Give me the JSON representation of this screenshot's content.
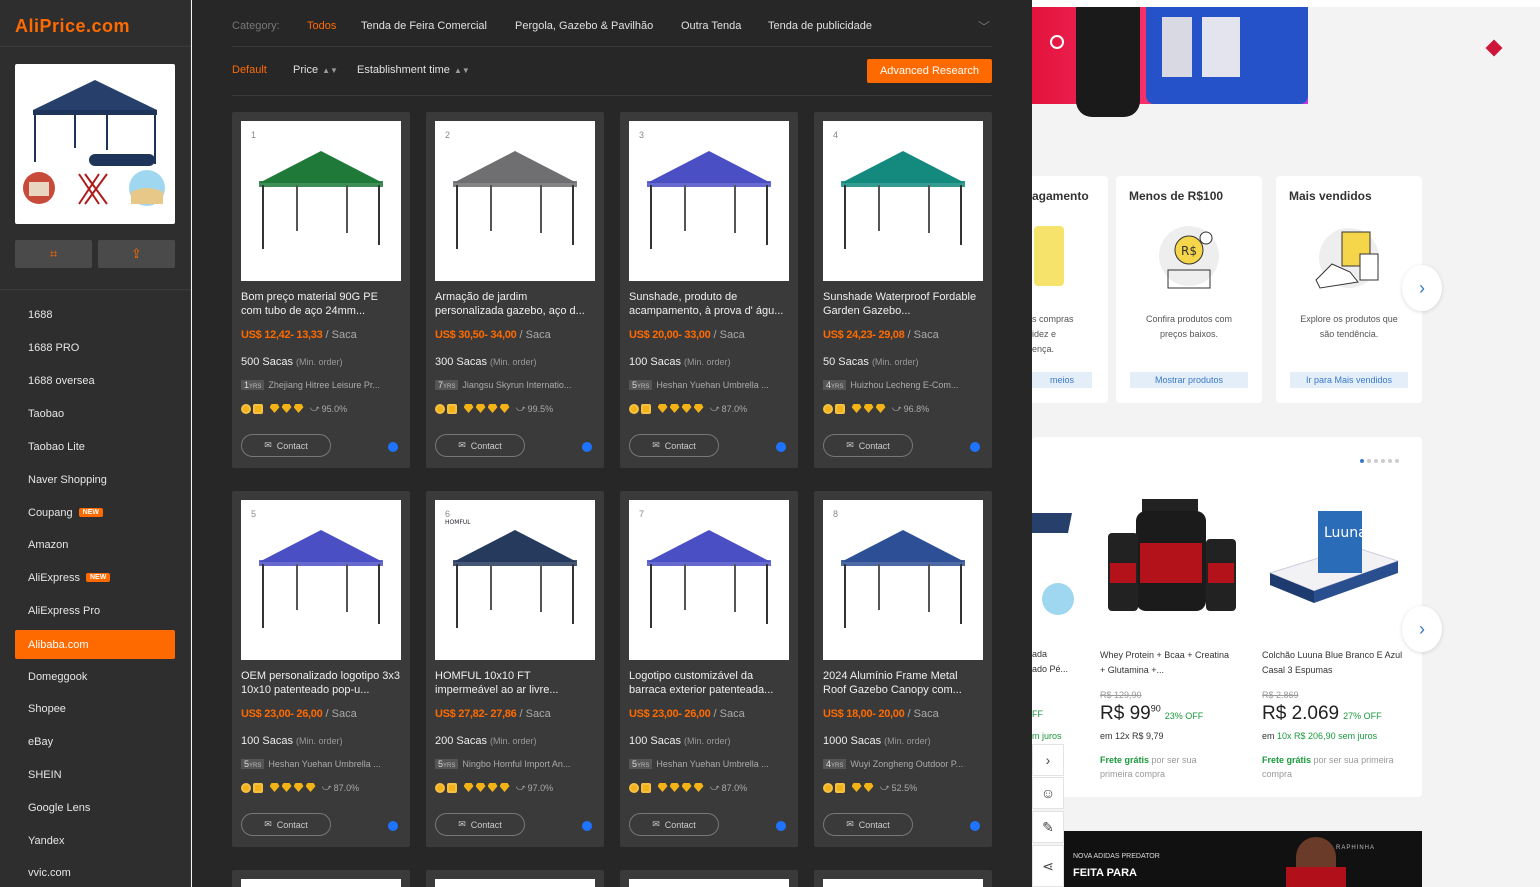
{
  "sidebar": {
    "logo": "AliPrice.com",
    "items": [
      {
        "label": "1688"
      },
      {
        "label": "1688 PRO"
      },
      {
        "label": "1688 oversea"
      },
      {
        "label": "Taobao"
      },
      {
        "label": "Taobao Lite"
      },
      {
        "label": "Naver Shopping"
      },
      {
        "label": "Coupang",
        "badge": "NEW"
      },
      {
        "label": "Amazon"
      },
      {
        "label": "AliExpress",
        "badge": "NEW"
      },
      {
        "label": "AliExpress Pro"
      },
      {
        "label": "Alibaba.com",
        "active": true
      },
      {
        "label": "Domeggook"
      },
      {
        "label": "Shopee"
      },
      {
        "label": "eBay"
      },
      {
        "label": "SHEIN"
      },
      {
        "label": "Google Lens"
      },
      {
        "label": "Yandex"
      },
      {
        "label": "vvic.com"
      }
    ],
    "crop_icon": "crop-icon",
    "upload_icon": "upload-icon"
  },
  "categories": {
    "label": "Category:",
    "items": [
      "Todos",
      "Tenda de Feira Comercial",
      "Pergola, Gazebo & Pavilhão",
      "Outra Tenda",
      "Tenda de publicidade"
    ],
    "selected": "Todos"
  },
  "sort": {
    "default": "Default",
    "price": "Price",
    "establishment": "Establishment time",
    "advanced": "Advanced Research"
  },
  "products": [
    {
      "num": "1",
      "title": "Bom preço material 90G PE com tubo de aço 24mm...",
      "price": "US$ 12,42- 13,33",
      "unit": "/ Saca",
      "moq": "500 Sacas",
      "moq_label": "(Min. order)",
      "yrs": "1",
      "yrs_label": "YRS",
      "supplier": "Zhejiang Hitree Leisure Pr...",
      "rating": "95.0%",
      "diamonds": 3,
      "color": "#1f7a3a",
      "contact": "Contact"
    },
    {
      "num": "2",
      "title": "Armação de jardim personalizada gazebo, aço d...",
      "price": "US$ 30,50- 34,00",
      "unit": "/ Saca",
      "moq": "300 Sacas",
      "moq_label": "(Min. order)",
      "yrs": "7",
      "yrs_label": "YRS",
      "supplier": "Jiangsu Skyrun Internatio...",
      "rating": "99.5%",
      "diamonds": 4,
      "color": "#6f6f72",
      "contact": "Contact"
    },
    {
      "num": "3",
      "title": "Sunshade, produto de acampamento, à prova d' águ...",
      "price": "US$ 20,00- 33,00",
      "unit": "/ Saca",
      "moq": "100 Sacas",
      "moq_label": "(Min. order)",
      "yrs": "5",
      "yrs_label": "YRS",
      "supplier": "Heshan Yuehan Umbrella ...",
      "rating": "87.0%",
      "diamonds": 4,
      "color": "#4b4fc4",
      "contact": "Contact"
    },
    {
      "num": "4",
      "title": "Sunshade Waterproof Fordable Garden Gazebo...",
      "price": "US$ 24,23- 29,08",
      "unit": "/ Saca",
      "moq": "50 Sacas",
      "moq_label": "(Min. order)",
      "yrs": "4",
      "yrs_label": "YRS",
      "supplier": "Huizhou Lecheng E-Com...",
      "rating": "96.8%",
      "diamonds": 3,
      "color": "#138a7d",
      "contact": "Contact"
    },
    {
      "num": "5",
      "title": "OEM personalizado logotipo 3x3 10x10 patenteado pop-u...",
      "price": "US$ 23,00- 26,00",
      "unit": "/ Saca",
      "moq": "100 Sacas",
      "moq_label": "(Min. order)",
      "yrs": "5",
      "yrs_label": "YRS",
      "supplier": "Heshan Yuehan Umbrella ...",
      "rating": "87.0%",
      "diamonds": 4,
      "color": "#4b4fc4",
      "contact": "Contact"
    },
    {
      "num": "6",
      "title": "HOMFUL 10x10 FT impermeável ao ar livre...",
      "price": "US$ 27,82- 27,86",
      "unit": "/ Saca",
      "moq": "200 Sacas",
      "moq_label": "(Min. order)",
      "yrs": "5",
      "yrs_label": "YRS",
      "supplier": "Ningbo Homful Import An...",
      "rating": "97.0%",
      "diamonds": 4,
      "color": "#263a5e",
      "contact": "Contact",
      "brand": "HOMFUL"
    },
    {
      "num": "7",
      "title": "Logotipo customizável da barraca exterior patenteada...",
      "price": "US$ 23,00- 26,00",
      "unit": "/ Saca",
      "moq": "100 Sacas",
      "moq_label": "(Min. order)",
      "yrs": "5",
      "yrs_label": "YRS",
      "supplier": "Heshan Yuehan Umbrella ...",
      "rating": "87.0%",
      "diamonds": 4,
      "color": "#4b4fc4",
      "contact": "Contact"
    },
    {
      "num": "8",
      "title": "2024 Alumínio Frame Metal Roof Gazebo Canopy com...",
      "price": "US$ 18,00- 20,00",
      "unit": "/ Saca",
      "moq": "1000 Sacas",
      "moq_label": "(Min. order)",
      "yrs": "4",
      "yrs_label": "YRS",
      "supplier": "Wuyi Zongheng Outdoor P...",
      "rating": "52.5%",
      "diamonds": 2,
      "color": "#2d4f96",
      "contact": "Contact"
    }
  ],
  "background": {
    "boxes": [
      {
        "title": "agamento",
        "desc": "s compras\nidez e\nença.",
        "btn": "meios"
      },
      {
        "title": "Menos de R$100",
        "desc": "Confira produtos com\npreços baixos.",
        "btn": "Mostrar produtos"
      },
      {
        "title": "Mais vendidos",
        "desc": "Explore os produtos que\nsão tendência.",
        "btn": "Ir para Mais vendidos"
      }
    ],
    "deals": [
      {
        "title": "ada\nado Pé...",
        "off": "FF",
        "inst": "m juros"
      },
      {
        "title": "Whey Protein + Bcaa + Creatina + Glutamina +...",
        "old": "R$ 129,90",
        "price": "R$ 99",
        "cents": "90",
        "off": "23% OFF",
        "inst": "em 12x R$ 9,79",
        "frete": "Frete grátis",
        "frete_rest": "por ser sua primeira compra"
      },
      {
        "title": "Colchão Luuna Blue Branco E Azul Casal 3 Espumas",
        "old": "R$ 2.869",
        "price": "R$ 2.069",
        "off": "27% OFF",
        "inst": "em",
        "inst_green": "10x R$ 206,90 sem juros",
        "frete": "Frete grátis",
        "frete_rest": "por ser sua primeira compra"
      }
    ],
    "mattress_brand": "Luuna",
    "promo_small": "NOVA ADIDAS PREDATOR",
    "promo_large": "FEITA PARA",
    "promo_brand": "RAPHINHA"
  }
}
